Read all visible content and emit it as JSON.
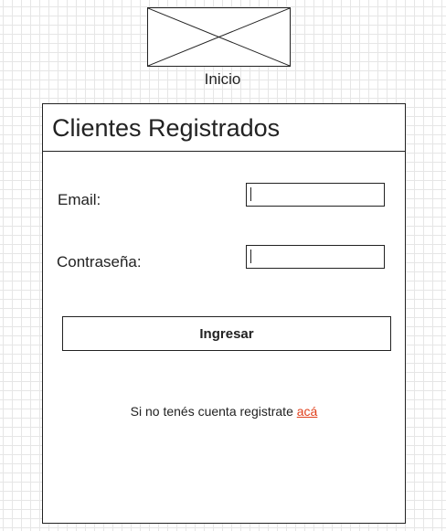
{
  "header": {
    "home_label": "Inicio"
  },
  "panel": {
    "title": "Clientes Registrados",
    "email_label": "Email:",
    "email_value": "",
    "password_label": "Contraseña:",
    "password_value": "",
    "submit_label": "Ingresar",
    "register_text": "Si no tenés cuenta registrate",
    "register_link": "acá"
  },
  "colors": {
    "link": "#e0401c",
    "border": "#222222",
    "grid": "#e6e6e6"
  },
  "icons": {
    "logo": "image-placeholder-icon"
  }
}
